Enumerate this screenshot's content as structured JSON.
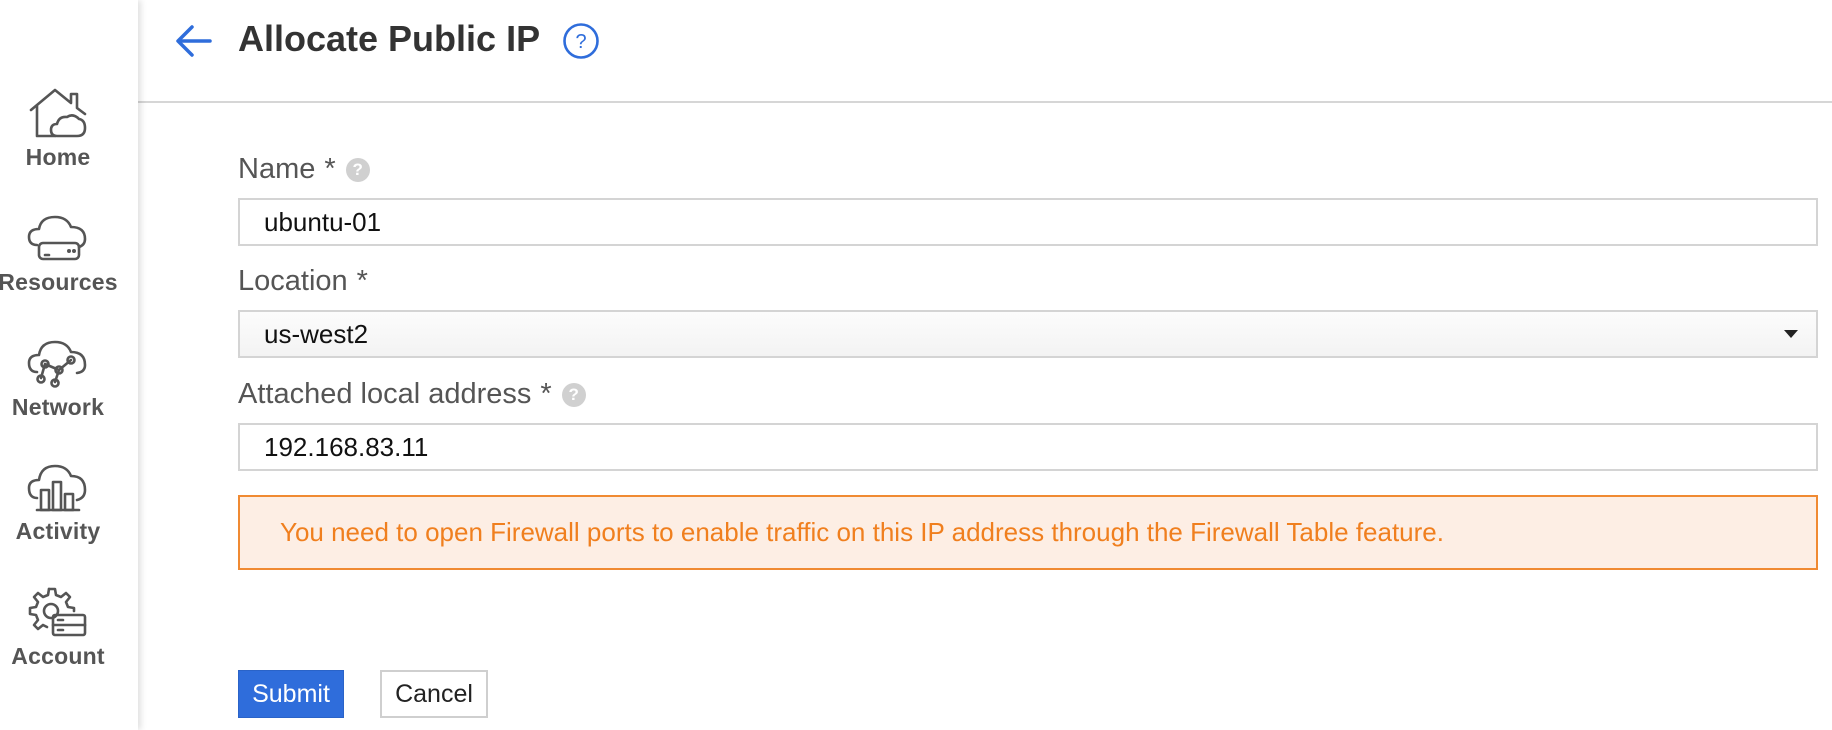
{
  "sidebar": {
    "items": [
      {
        "label": "Home",
        "icon": "home-cloud-icon"
      },
      {
        "label": "Resources",
        "icon": "cloud-server-icon"
      },
      {
        "label": "Network",
        "icon": "cloud-network-icon"
      },
      {
        "label": "Activity",
        "icon": "cloud-chart-icon"
      },
      {
        "label": "Account",
        "icon": "gear-account-icon"
      }
    ]
  },
  "header": {
    "title": "Allocate Public IP",
    "help_glyph": "?"
  },
  "form": {
    "name": {
      "label": "Name",
      "required": "*",
      "value": "ubuntu-01"
    },
    "location": {
      "label": "Location",
      "required": "*",
      "value": "us-west2"
    },
    "local_address": {
      "label": "Attached local address",
      "required": "*",
      "value": "192.168.83.11"
    },
    "help_glyph": "?"
  },
  "alert": {
    "message": "You need to open Firewall ports to enable traffic on this IP address through the Firewall Table feature."
  },
  "actions": {
    "submit_label": "Submit",
    "cancel_label": "Cancel"
  },
  "colors": {
    "accent": "#2f6ddb",
    "warning_border": "#f08a32",
    "warning_bg": "#fdeee4",
    "warning_text": "#f07f1e"
  }
}
